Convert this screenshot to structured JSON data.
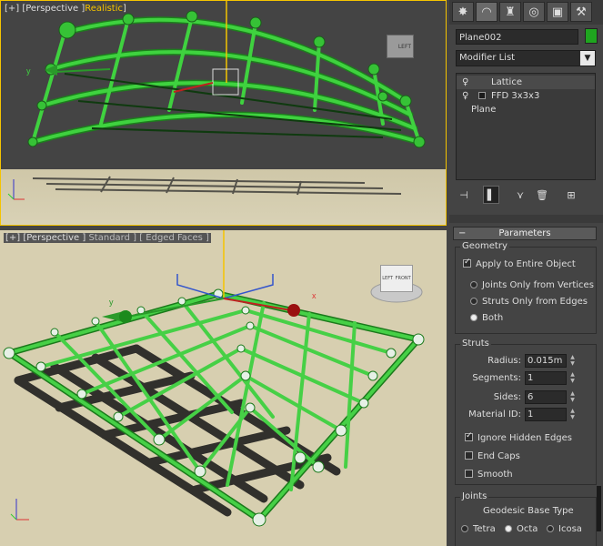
{
  "viewport_top": {
    "label_prefix": "[+] [Perspective ]",
    "label_mode": "Realistic",
    "label_suffix": "]",
    "viewcube_label": "LEFT"
  },
  "viewport_bottom": {
    "label_prefix": "[+] [Perspective ]",
    "label_mode": "Standard ] [ Edged Faces ]",
    "viewcube_label_a": "LEFT",
    "viewcube_label_b": "FRONT"
  },
  "command_panel": {
    "tabs": [
      "create-icon",
      "modify-icon",
      "hierarchy-icon",
      "motion-icon",
      "display-icon",
      "utilities-icon"
    ],
    "object_name": "Plane002",
    "object_color": "#1fa51f",
    "modifier_list_label": "Modifier List",
    "stack": [
      "Lattice",
      "FFD 3x3x3",
      "Plane"
    ],
    "rollout_title": "Parameters",
    "geometry": {
      "title": "Geometry",
      "apply_entire": "Apply to Entire Object",
      "joints_only": "Joints Only from Vertices",
      "struts_only": "Struts Only from Edges",
      "both": "Both"
    },
    "struts": {
      "title": "Struts",
      "radius_label": "Radius:",
      "radius_value": "0.015m",
      "segments_label": "Segments:",
      "segments_value": "1",
      "sides_label": "Sides:",
      "sides_value": "6",
      "material_label": "Material ID:",
      "material_value": "1",
      "ignore_hidden": "Ignore Hidden Edges",
      "end_caps": "End Caps",
      "smooth": "Smooth"
    },
    "joints": {
      "title": "Joints",
      "geodesic_label": "Geodesic Base Type",
      "tetra": "Tetra",
      "octa": "Octa",
      "icosa": "Icosa"
    }
  },
  "colors": {
    "accent_active": "#f5c400",
    "lattice_green": "#2fb82f",
    "floor": "#d7cfb0"
  }
}
